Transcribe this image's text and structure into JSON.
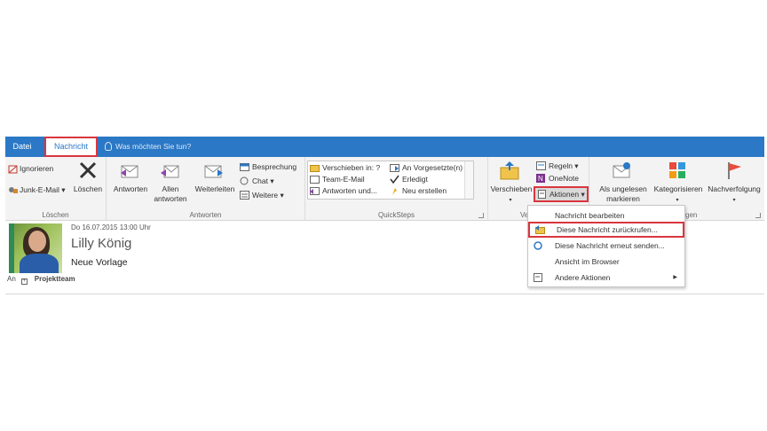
{
  "tabs": {
    "file": "Datei",
    "message": "Nachricht"
  },
  "tell_me": "Was möchten Sie tun?",
  "groups": {
    "delete": {
      "label": "Löschen",
      "ignore": "Ignorieren",
      "junk": "Junk-E-Mail",
      "delete": "Löschen"
    },
    "respond": {
      "label": "Antworten",
      "reply": "Antworten",
      "reply_all_1": "Allen",
      "reply_all_2": "antworten",
      "forward": "Weiterleiten",
      "meeting": "Besprechung",
      "chat": "Chat",
      "more": "Weitere"
    },
    "quicksteps": {
      "label": "QuickSteps",
      "items": [
        "Verschieben in: ?",
        "Team-E-Mail",
        "Antworten und...",
        "An Vorgesetzte(n)",
        "Erledigt",
        "Neu erstellen"
      ]
    },
    "move": {
      "label": "Vers",
      "move": "Verschieben",
      "rules": "Regeln",
      "onenote": "OneNote",
      "actions": "Aktionen"
    },
    "tags": {
      "label": "gen",
      "unread_1": "Als ungelesen",
      "unread_2": "markieren",
      "categorize": "Kategorisieren",
      "followup": "Nachverfolgung"
    }
  },
  "message": {
    "date": "Do 16.07.2015 13:00 Uhr",
    "sender": "Lilly König",
    "subject": "Neue Vorlage",
    "to_label": "An",
    "to_value": "Projektteam"
  },
  "actions_menu": {
    "items": [
      "Nachricht bearbeiten",
      "Diese Nachricht zurückrufen...",
      "Diese Nachricht erneut senden...",
      "Ansicht im Browser",
      "Andere Aktionen"
    ]
  },
  "colors": {
    "accent": "#2b78c6",
    "highlight": "#d9363e"
  }
}
